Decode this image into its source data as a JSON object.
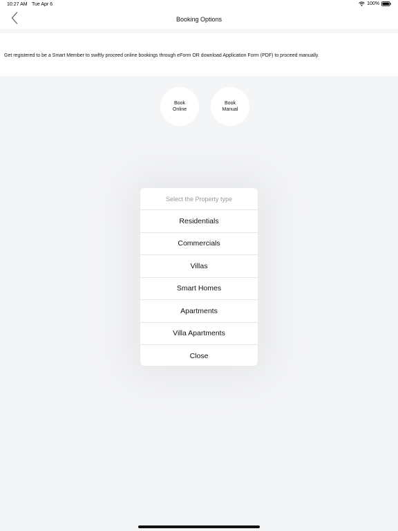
{
  "status_bar": {
    "time": "10:27 AM",
    "date": "Tue Apr 6",
    "battery": "100%"
  },
  "nav": {
    "title": "Booking Options",
    "back_icon": "chevron-left-icon"
  },
  "banner": {
    "text": "Get registered to be a Smart Member to swiftly proceed online bookings through eForm OR download Application Form (PDF) to proceed manually."
  },
  "options": [
    {
      "line1": "Book",
      "line2": "Online"
    },
    {
      "line1": "Book",
      "line2": "Manual"
    }
  ],
  "sheet": {
    "header": "Select the Property type",
    "items": [
      "Residentials",
      "Commercials",
      "Villas",
      "Smart Homes",
      "Apartments",
      "Villa Apartments",
      "Close"
    ]
  }
}
